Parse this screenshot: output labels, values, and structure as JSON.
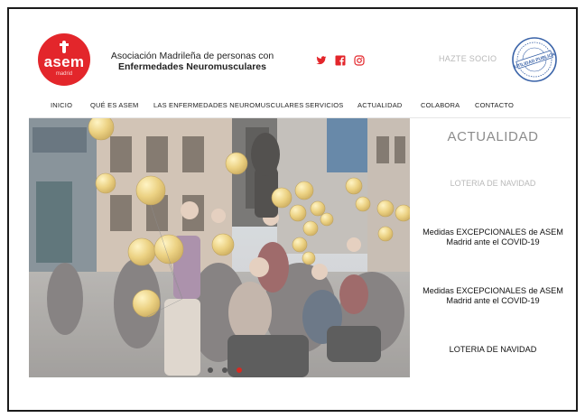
{
  "logo": {
    "word": "asem",
    "sub": "madrid"
  },
  "org": {
    "line1": "Asociación Madrileña de personas con",
    "line2": "Enfermedades Neuromusculares"
  },
  "social": [
    {
      "icon": "twitter-icon"
    },
    {
      "icon": "facebook-icon"
    },
    {
      "icon": "instagram-icon"
    }
  ],
  "hazte_socio": "HAZTE SOCIO",
  "seal": {
    "text": "UTILIDAD PUBLICA"
  },
  "nav": [
    {
      "label": "INICIO"
    },
    {
      "label": "QUÉ ES ASEM"
    },
    {
      "label": "LAS ENFERMEDADES NEUROMUSCULARES"
    },
    {
      "label": "SERVICIOS"
    },
    {
      "label": "ACTUALIDAD"
    },
    {
      "label": "COLABORA"
    },
    {
      "label": "CONTACTO"
    }
  ],
  "hero": {
    "slides_count": 3,
    "active_slide": 3
  },
  "sidebar": {
    "title": "ACTUALIDAD",
    "items": [
      {
        "label": "LOTERIA DE NAVIDAD"
      },
      {
        "label": "Medidas EXCEPCIONALES de ASEM Madrid ante el COVID-19"
      },
      {
        "label": "Medidas EXCEPCIONALES de ASEM Madrid ante el COVID-19"
      },
      {
        "label": "LOTERIA DE NAVIDAD"
      }
    ]
  },
  "colors": {
    "brand_red": "#e3262b",
    "text_dark": "#222222",
    "muted": "#b8b8b8",
    "seal_blue": "#3a63a8",
    "dot_active": "#d72a22",
    "dot_inactive": "#555555"
  }
}
